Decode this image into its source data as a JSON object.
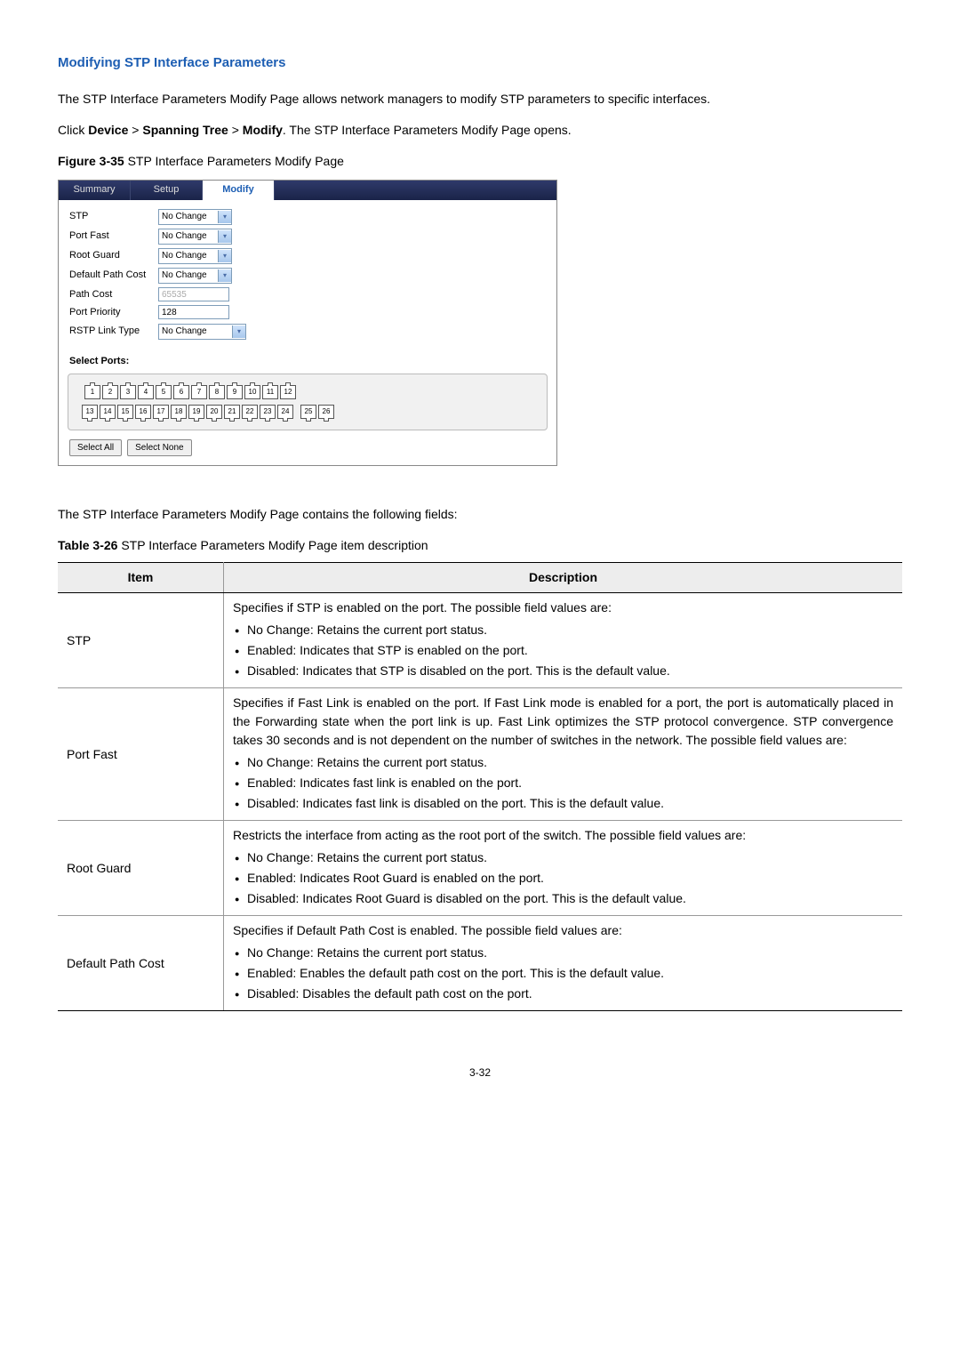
{
  "heading": "Modifying STP Interface Parameters",
  "intro": "The STP Interface Parameters Modify Page allows network managers to modify STP parameters to specific interfaces.",
  "nav_line_prefix": "Click ",
  "nav_device": "Device",
  "nav_gt1": " > ",
  "nav_spanning": "Spanning Tree",
  "nav_gt2": " > ",
  "nav_modify": "Modify",
  "nav_suffix": ". The STP Interface Parameters Modify Page opens.",
  "figure_bold": "Figure 3-35 ",
  "figure_rest": "STP Interface Parameters Modify Page",
  "tabs": {
    "summary": "Summary",
    "setup": "Setup",
    "modify": "Modify"
  },
  "form": {
    "stp_label": "STP",
    "stp_value": "No Change",
    "portfast_label": "Port Fast",
    "portfast_value": "No Change",
    "rootguard_label": "Root Guard",
    "rootguard_value": "No Change",
    "defpath_label": "Default Path Cost",
    "defpath_value": "No Change",
    "pathcost_label": "Path Cost",
    "pathcost_value": "65535",
    "portpri_label": "Port Priority",
    "portpri_value": "128",
    "rstp_label": "RSTP Link Type",
    "rstp_value": "No Change"
  },
  "select_ports": "Select Ports:",
  "ports_top": [
    "1",
    "2",
    "3",
    "4",
    "5",
    "6",
    "7",
    "8",
    "9",
    "10",
    "11",
    "12"
  ],
  "ports_bottom": [
    "13",
    "14",
    "15",
    "16",
    "17",
    "18",
    "19",
    "20",
    "21",
    "22",
    "23",
    "24",
    "25",
    "26"
  ],
  "btn_all": "Select All",
  "btn_none": "Select None",
  "after_figure": "The STP Interface Parameters Modify Page contains the following fields:",
  "table_bold": "Table 3-26 ",
  "table_rest": "STP Interface Parameters Modify Page item description",
  "th_item": "Item",
  "th_desc": "Description",
  "rows": {
    "stp": {
      "item": "STP",
      "intro": "Specifies if STP is enabled on the port. The possible field values are:",
      "b1": "No Change: Retains the current port status.",
      "b2": "Enabled: Indicates that STP is enabled on the port.",
      "b3": "Disabled: Indicates that STP is disabled on the port. This is the default value."
    },
    "portfast": {
      "item": "Port Fast",
      "intro": "Specifies if Fast Link is enabled on the port. If Fast Link mode is enabled for a port, the port is automatically placed in the Forwarding state when the port link is up. Fast Link optimizes the STP protocol convergence. STP convergence takes 30 seconds and is not dependent on the number of switches in the network. The possible field values are:",
      "b1": "No Change: Retains the current port status.",
      "b2": "Enabled: Indicates fast link is enabled on the port.",
      "b3": "Disabled: Indicates fast link is disabled on the port. This is the default value."
    },
    "rootguard": {
      "item": "Root Guard",
      "intro": "Restricts the interface from acting as the root port of the switch. The possible field values are:",
      "b1": "No Change: Retains the current port status.",
      "b2": "Enabled: Indicates Root Guard is enabled on the port.",
      "b3": "Disabled: Indicates Root Guard is disabled on the port. This is the default value."
    },
    "defpath": {
      "item": "Default Path Cost",
      "intro": "Specifies if Default Path Cost is enabled. The possible field values are:",
      "b1": "No Change: Retains the current port status.",
      "b2": "Enabled: Enables the default path cost on the port. This is the default value.",
      "b3": "Disabled: Disables the default path cost on the port."
    }
  },
  "page_num": "3-32"
}
